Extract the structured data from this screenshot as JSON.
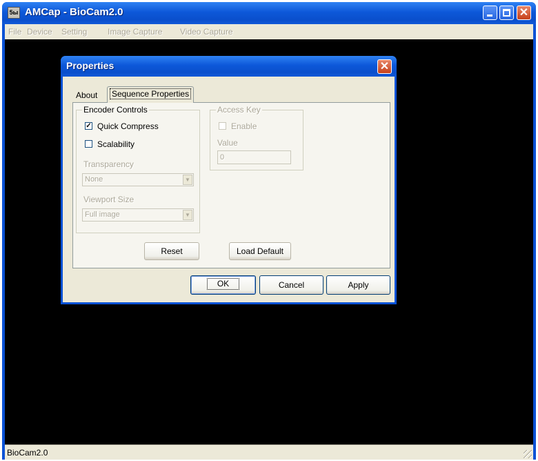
{
  "window": {
    "title": "AMCap - BioCam2.0",
    "icon_text": "5ы",
    "menu": [
      "File",
      "Device",
      "Setting",
      "Image Capture",
      "Video Capture"
    ],
    "status_text": "BioCam2.0"
  },
  "dialog": {
    "title": "Properties",
    "tabs": [
      "About",
      "Sequence Properties"
    ],
    "active_tab": "Sequence Properties",
    "encoder_controls": {
      "label": "Encoder Controls",
      "quick_compress": {
        "label": "Quick Compress",
        "checked": true
      },
      "scalability": {
        "label": "Scalability",
        "checked": false
      },
      "transparency": {
        "label": "Transparency",
        "value": "None"
      },
      "viewport_size": {
        "label": "Viewport Size",
        "value": "Full image"
      }
    },
    "access_key": {
      "label": "Access Key",
      "enable": {
        "label": "Enable",
        "checked": false
      },
      "value_label": "Value",
      "value": "0"
    },
    "buttons": {
      "reset": "Reset",
      "load_default": "Load Default",
      "ok": "OK",
      "cancel": "Cancel",
      "apply": "Apply"
    }
  },
  "colors": {
    "titlebar": "#0a52d6",
    "dialog_face": "#ece9d8",
    "video_background": "#000000",
    "close_button": "#d6532a"
  },
  "icons": [
    "app-icon",
    "minimize-icon",
    "maximize-icon",
    "close-icon",
    "checkmark-icon",
    "dropdown-arrow-icon",
    "resize-grip-icon"
  ]
}
